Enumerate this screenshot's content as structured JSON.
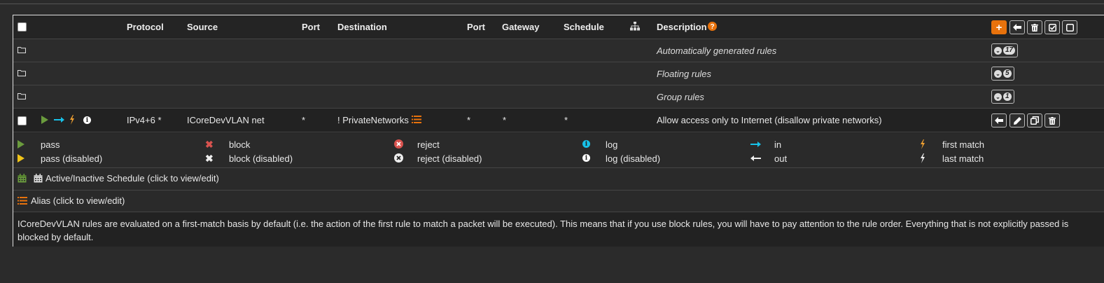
{
  "header": {
    "protocol": "Protocol",
    "source": "Source",
    "port": "Port",
    "destination": "Destination",
    "port2": "Port",
    "gateway": "Gateway",
    "schedule": "Schedule",
    "description": "Description"
  },
  "groups": [
    {
      "label": "Automatically generated rules",
      "count": "17"
    },
    {
      "label": "Floating rules",
      "count": "5"
    },
    {
      "label": "Group rules",
      "count": "1"
    }
  ],
  "rule": {
    "protocol": "IPv4+6 *",
    "source": "ICoreDevVLAN net",
    "port": "*",
    "destination": "! PrivateNetworks",
    "port2": "*",
    "gateway": "*",
    "schedule": "*",
    "description": "Allow access only to Internet (disallow private networks)"
  },
  "legend": {
    "pass": "pass",
    "pass_disabled": "pass (disabled)",
    "block": "block",
    "block_disabled": "block (disabled)",
    "reject": "reject",
    "reject_disabled": "reject (disabled)",
    "log": "log",
    "log_disabled": "log (disabled)",
    "in": "in",
    "out": "out",
    "first_match": "first match",
    "last_match": "last match"
  },
  "schedule_legend": "Active/Inactive Schedule (click to view/edit)",
  "alias_legend": "Alias (click to view/edit)",
  "footer_text": "ICoreDevVLAN rules are evaluated on a first-match basis by default (i.e. the action of the first rule to match a packet will be executed). This means that if you use block rules, you will have to pay attention to the rule order. Everything that is not explicitly passed is blocked by default.",
  "colors": {
    "pass": "#6a9b3d",
    "pass_disabled": "#f0c419",
    "block": "#d9534f",
    "reject": "#d9534f",
    "log": "#17c1e8",
    "in_arrow": "#17c1e8",
    "first_match": "#f0a030",
    "accent": "#e8720c"
  },
  "icons": [
    "folder-icon",
    "play-icon",
    "arrow-right-icon",
    "bolt-icon",
    "info-icon",
    "sitemap-icon",
    "help-icon",
    "list-icon",
    "calendar-icon",
    "plus-icon",
    "arrow-left-icon",
    "trash-icon",
    "check-square-icon",
    "square-icon",
    "chevron-down-icon",
    "pencil-icon",
    "copy-icon",
    "times-icon",
    "times-circle-icon"
  ]
}
